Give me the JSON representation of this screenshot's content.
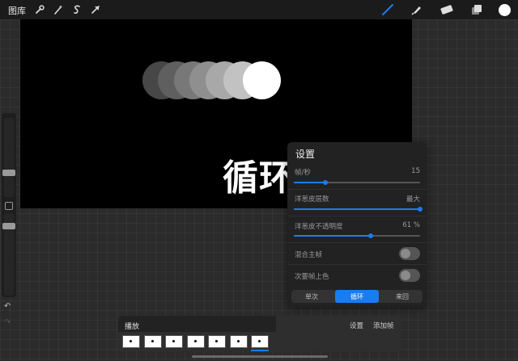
{
  "topbar": {
    "gallery_label": "图库",
    "left_tools": [
      "wrench-icon",
      "magic-wand-icon",
      "selection-icon",
      "arrow-icon"
    ],
    "right_tools": [
      "brush-icon",
      "smudge-icon",
      "eraser-icon",
      "layers-icon",
      "color-swatch"
    ],
    "active_tool": "brush-icon",
    "accent_color": "#1a7cf2",
    "color_swatch": "#ffffff"
  },
  "canvas": {
    "background": "#000000",
    "overlay_text": "循环"
  },
  "sidebar": {
    "brush_size_level": 0.35,
    "opacity_level": 0.65,
    "undo_icon": "undo-icon",
    "redo_icon": "redo-icon"
  },
  "settings_panel": {
    "title": "设置",
    "fps": {
      "label": "帧/秒",
      "value": "15",
      "level": 0.25
    },
    "onion_layers": {
      "label": "洋葱皮层数",
      "value": "最大",
      "level": 1.0
    },
    "onion_opacity": {
      "label": "洋葱皮不透明度",
      "value": "61 %",
      "level": 0.61
    },
    "blend_primary": {
      "label": "混合主帧",
      "on": false
    },
    "color_secondary": {
      "label": "次要帧上色",
      "on": false
    },
    "modes": [
      {
        "label": "单次",
        "active": false
      },
      {
        "label": "循环",
        "active": true
      },
      {
        "label": "来回",
        "active": false
      }
    ]
  },
  "timeline": {
    "play_label": "播放",
    "settings_label": "设置",
    "add_frame_label": "添加帧",
    "frame_count": 7,
    "selected_frame": 7
  }
}
